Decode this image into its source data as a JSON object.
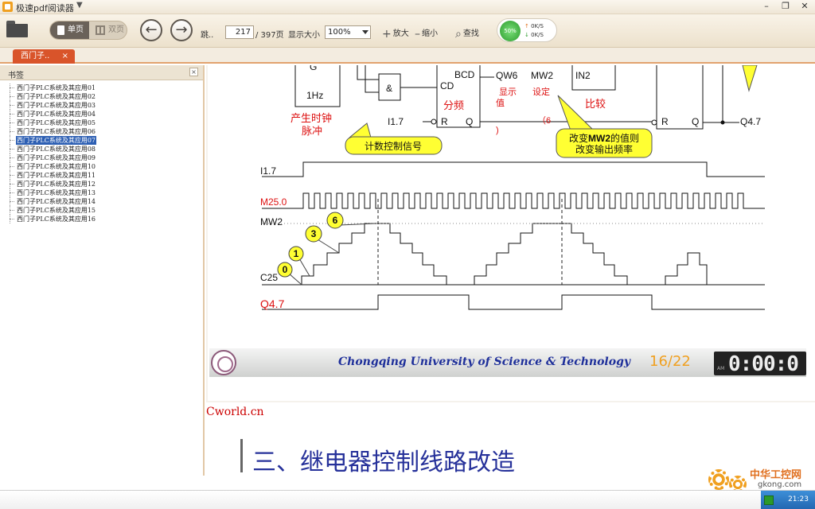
{
  "window": {
    "title": "极速pdf阅读器",
    "menu_glyph": "▼",
    "minimize": "–",
    "restore": "❐",
    "close": "✕"
  },
  "toolbar": {
    "single_label": "单页",
    "double_label": "双页",
    "prev_glyph": "←",
    "next_glyph": "→",
    "jump_label": "跳..",
    "current_page": "217",
    "total_pages": "/ 397页",
    "zoom_label": "显示大小",
    "zoom_value": "100%",
    "zoom_in_label": "放大",
    "zoom_out_label": "缩小",
    "find_label": "查找"
  },
  "speed": {
    "percent": "50%",
    "up": "0K/S",
    "down": "0K/S"
  },
  "tabs": [
    {
      "label": "西门子..",
      "close": "×"
    }
  ],
  "sidebar": {
    "title": "书签",
    "close": "×",
    "bookmarks": [
      "西门子PLC系统及其应用01",
      "西门子PLC系统及其应用02",
      "西门子PLC系统及其应用03",
      "西门子PLC系统及其应用04",
      "西门子PLC系统及其应用05",
      "西门子PLC系统及其应用06",
      "西门子PLC系统及其应用07",
      "西门子PLC系统及其应用08",
      "西门子PLC系统及其应用09",
      "西门子PLC系统及其应用10",
      "西门子PLC系统及其应用11",
      "西门子PLC系统及其应用12",
      "西门子PLC系统及其应用13",
      "西门子PLC系统及其应用14",
      "西门子PLC系统及其应用15",
      "西门子PLC系统及其应用16"
    ],
    "selected_index": 6
  },
  "diagram": {
    "gen_label": "G",
    "gen_freq": "1Hz",
    "gen_caption1": "产生时钟",
    "gen_caption2": "脉冲",
    "and_label": "&",
    "bcd_label": "BCD",
    "cd_label": "CD",
    "r_label": "R",
    "q_label": "Q",
    "divider_caption": "分频",
    "i17_label": "I1.7",
    "qw6_label": "QW6",
    "display_caption1": "显示",
    "display_caption2": "值",
    "display_paren": ")",
    "mw2_label": "MW2",
    "setting_caption": "设定",
    "setting_paren": "（6",
    "in2_label": "IN2",
    "compare_caption": "比较",
    "r2_label": "R",
    "q2_label": "Q",
    "q47_label": "Q4.7",
    "callout_count": "计数控制信号",
    "callout_mw2_line1_pre": "改变",
    "callout_mw2_line1_bold": "MW2",
    "callout_mw2_line1_post": "的值则",
    "callout_mw2_line2": "改变输出频率",
    "timing_i17": "I1.7",
    "timing_m250": "M25.0",
    "timing_mw2": "MW2",
    "timing_c25": "C25",
    "timing_q47": "Q4.7",
    "bubble0": "0",
    "bubble1": "1",
    "bubble3": "3",
    "bubble6": "6"
  },
  "slide_footer": {
    "university": "Chongqing University of Science & Technology",
    "page": "16/22",
    "clock_ampm": "AM",
    "clock": "0:00:0"
  },
  "page2": {
    "source": "Cworld.cn",
    "heading": "三、继电器控制线路改造"
  },
  "watermark": {
    "brand": "中华工控网",
    "site": "gkong.com"
  },
  "taskbar": {
    "time": "21:23"
  },
  "colors": {
    "accent_orange": "#d9542a",
    "selection_blue": "#2d5fb3",
    "diagram_red": "#dd1111",
    "callout_yellow": "#ffff33",
    "heading_blue": "#26319a"
  }
}
